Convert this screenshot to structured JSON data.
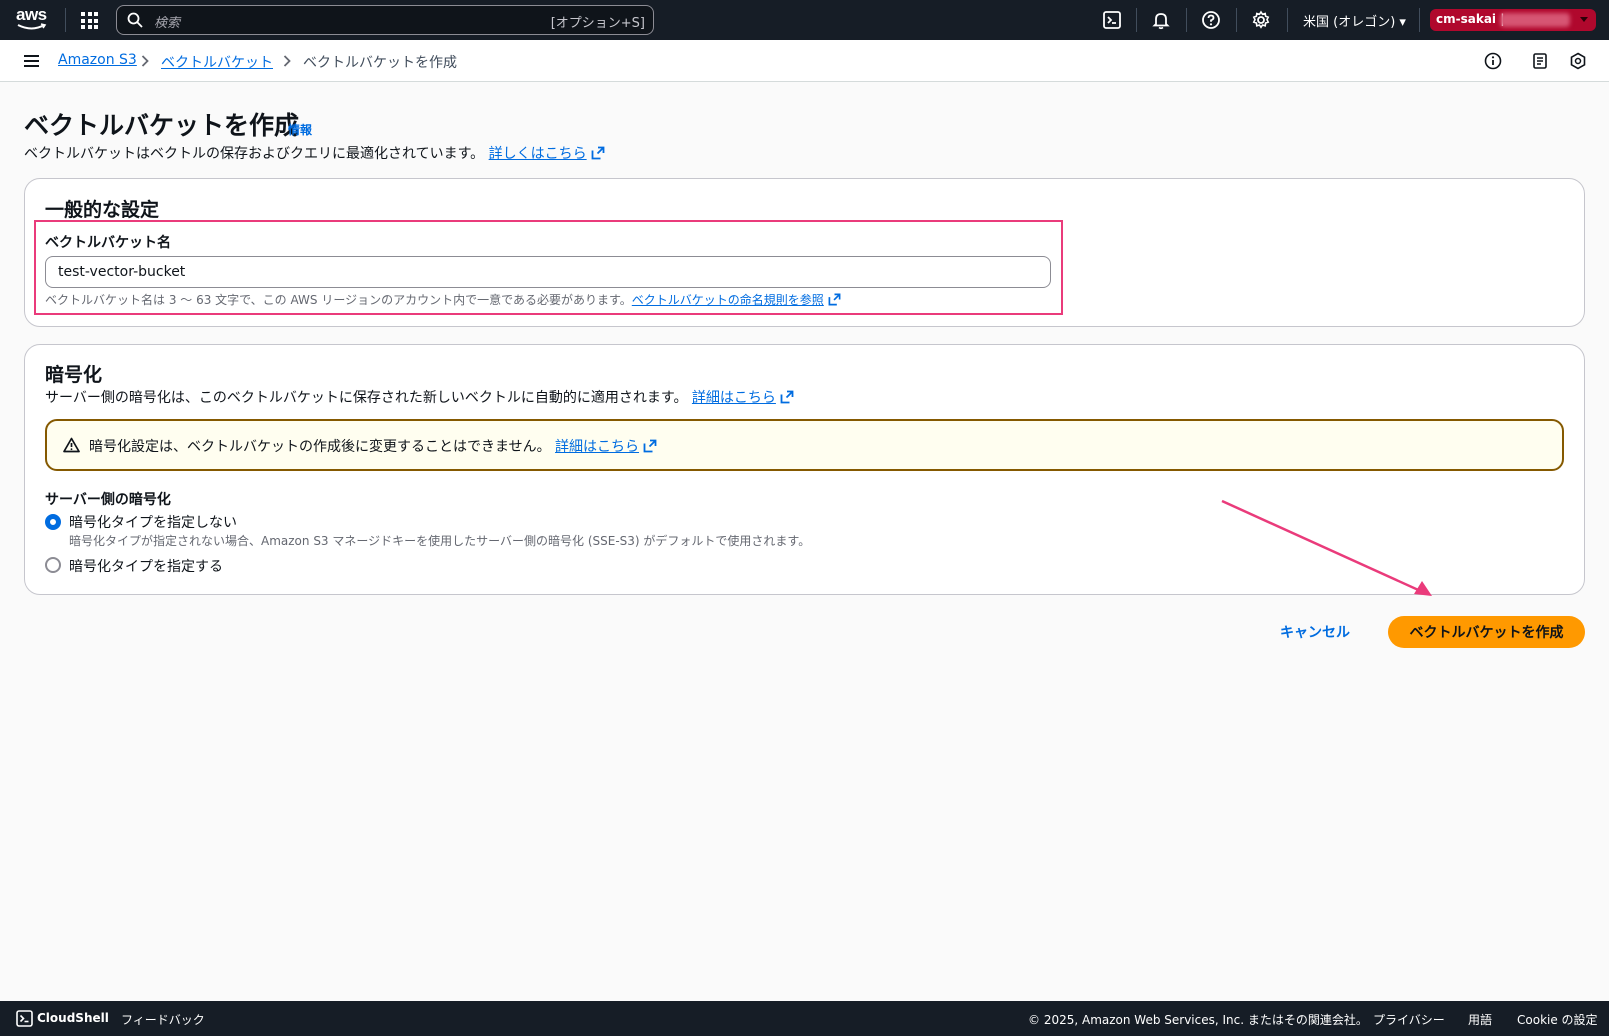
{
  "topnav": {
    "logo_text": "aws",
    "search_placeholder": "検索",
    "search_shortcut": "[オプション+S]",
    "region": "米国 (オレゴン) ▾",
    "account": "cm-sakai |"
  },
  "breadcrumb": {
    "items": [
      "Amazon S3",
      "ベクトルバケット",
      "ベクトルバケットを作成"
    ]
  },
  "page": {
    "title": "ベクトルバケットを作成",
    "info": "情報",
    "description": "ベクトルバケットはベクトルの保存およびクエリに最適化されています。",
    "learn_more": "詳しくはこちら"
  },
  "general": {
    "heading": "一般的な設定",
    "name_label": "ベクトルバケット名",
    "name_value": "test-vector-bucket",
    "name_hint": "ベクトルバケット名は 3 〜 63 文字で、この AWS リージョンのアカウント内で一意である必要があります。",
    "name_hint_link": "ベクトルバケットの命名規則を参照"
  },
  "encryption": {
    "heading": "暗号化",
    "description": "サーバー側の暗号化は、このベクトルバケットに保存された新しいベクトルに自動的に適用されます。",
    "details_link": "詳細はこちら",
    "alert_text": "暗号化設定は、ベクトルバケットの作成後に変更することはできません。",
    "alert_link": "詳細はこちら",
    "sse_label": "サーバー側の暗号化",
    "option1_label": "暗号化タイプを指定しない",
    "option1_desc": "暗号化タイプが指定されない場合、Amazon S3 マネージドキーを使用したサーバー側の暗号化 (SSE-S3) がデフォルトで使用されます。",
    "option2_label": "暗号化タイプを指定する",
    "selected": "option1"
  },
  "actions": {
    "cancel": "キャンセル",
    "create": "ベクトルバケットを作成"
  },
  "footer": {
    "cloudshell": "CloudShell",
    "feedback": "フィードバック",
    "copyright": "© 2025, Amazon Web Services, Inc. またはその関連会社。",
    "privacy": "プライバシー",
    "terms": "用語",
    "cookie": "Cookie の設定"
  },
  "colors": {
    "nav_bg": "#161d26",
    "link": "#006ce0",
    "primary": "#ff9900",
    "highlight": "#ea3b7b",
    "warning_border": "#855900",
    "account_bg": "#b0082d"
  }
}
